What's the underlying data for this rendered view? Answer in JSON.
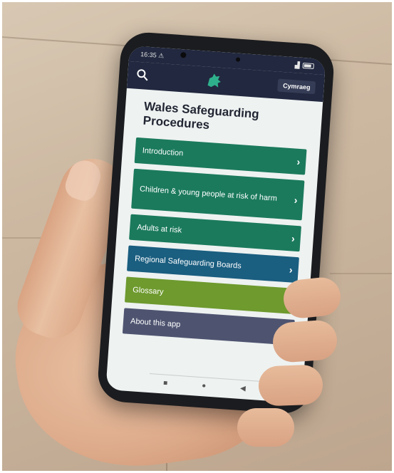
{
  "status_bar": {
    "time": "16:35 ⚠"
  },
  "app_bar": {
    "language_button": "Cymraeg"
  },
  "page_title": "Wales Safeguarding Procedures",
  "menu": [
    {
      "label": "Introduction",
      "color": "#1b7a5c"
    },
    {
      "label": "Children & young people at risk of harm",
      "color": "#1b7a5c"
    },
    {
      "label": "Adults at risk",
      "color": "#1b7a5c"
    },
    {
      "label": "Regional Safeguarding Boards",
      "color": "#1a5e80"
    },
    {
      "label": "Glossary",
      "color": "#6e9a2e"
    },
    {
      "label": "About this app",
      "color": "#4e5470"
    }
  ],
  "nav": {
    "recent": "■",
    "home": "●",
    "back": "◀"
  },
  "colors": {
    "app_bar": "#21283f",
    "screen_bg": "#eef2f1",
    "title": "#222633"
  },
  "icons": [
    "search-icon",
    "wales-dragon-logo-icon",
    "chevron-right-icon",
    "battery-icon",
    "signal-icon"
  ]
}
